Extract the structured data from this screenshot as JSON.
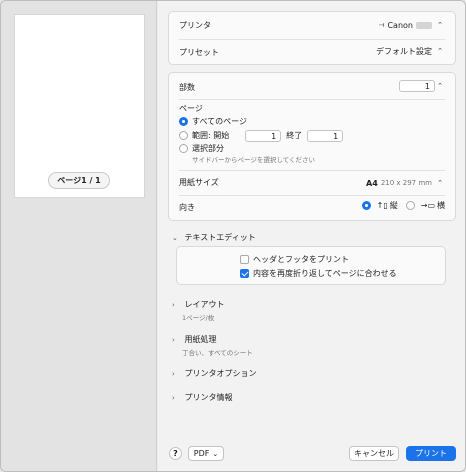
{
  "sidebar": {
    "page_indicator": "ページ1 / 1"
  },
  "printer": {
    "label": "プリンタ",
    "value": "Canon"
  },
  "preset": {
    "label": "プリセット",
    "value": "デフォルト設定"
  },
  "copies": {
    "label": "部数",
    "value": "1"
  },
  "pages": {
    "label": "ページ",
    "all_label": "すべてのページ",
    "range_label": "範囲: 開始",
    "range_from": "1",
    "range_to_label": "終了",
    "range_to": "1",
    "selection_label": "選択部分",
    "selection_hint": "サイドバーからページを選択してください"
  },
  "paper_size": {
    "label": "用紙サイズ",
    "value": "A4",
    "dimensions": "210 x 297 mm"
  },
  "orientation": {
    "label": "向き",
    "portrait": "縦",
    "landscape": "横"
  },
  "text_edit": {
    "title": "テキストエディット",
    "header_footer": "ヘッダとフッタをプリント",
    "rewrap": "内容を再度折り返してページに合わせる"
  },
  "sections": [
    {
      "title": "レイアウト",
      "subtitle": "1ページ/枚"
    },
    {
      "title": "用紙処理",
      "subtitle": "丁合い、すべてのシート"
    },
    {
      "title": "プリンタオプション",
      "subtitle": ""
    },
    {
      "title": "プリンタ情報",
      "subtitle": ""
    }
  ],
  "footer": {
    "help": "?",
    "pdf": "PDF",
    "cancel": "キャンセル",
    "print": "プリント"
  },
  "colors": {
    "accent": "#1a73e8"
  }
}
